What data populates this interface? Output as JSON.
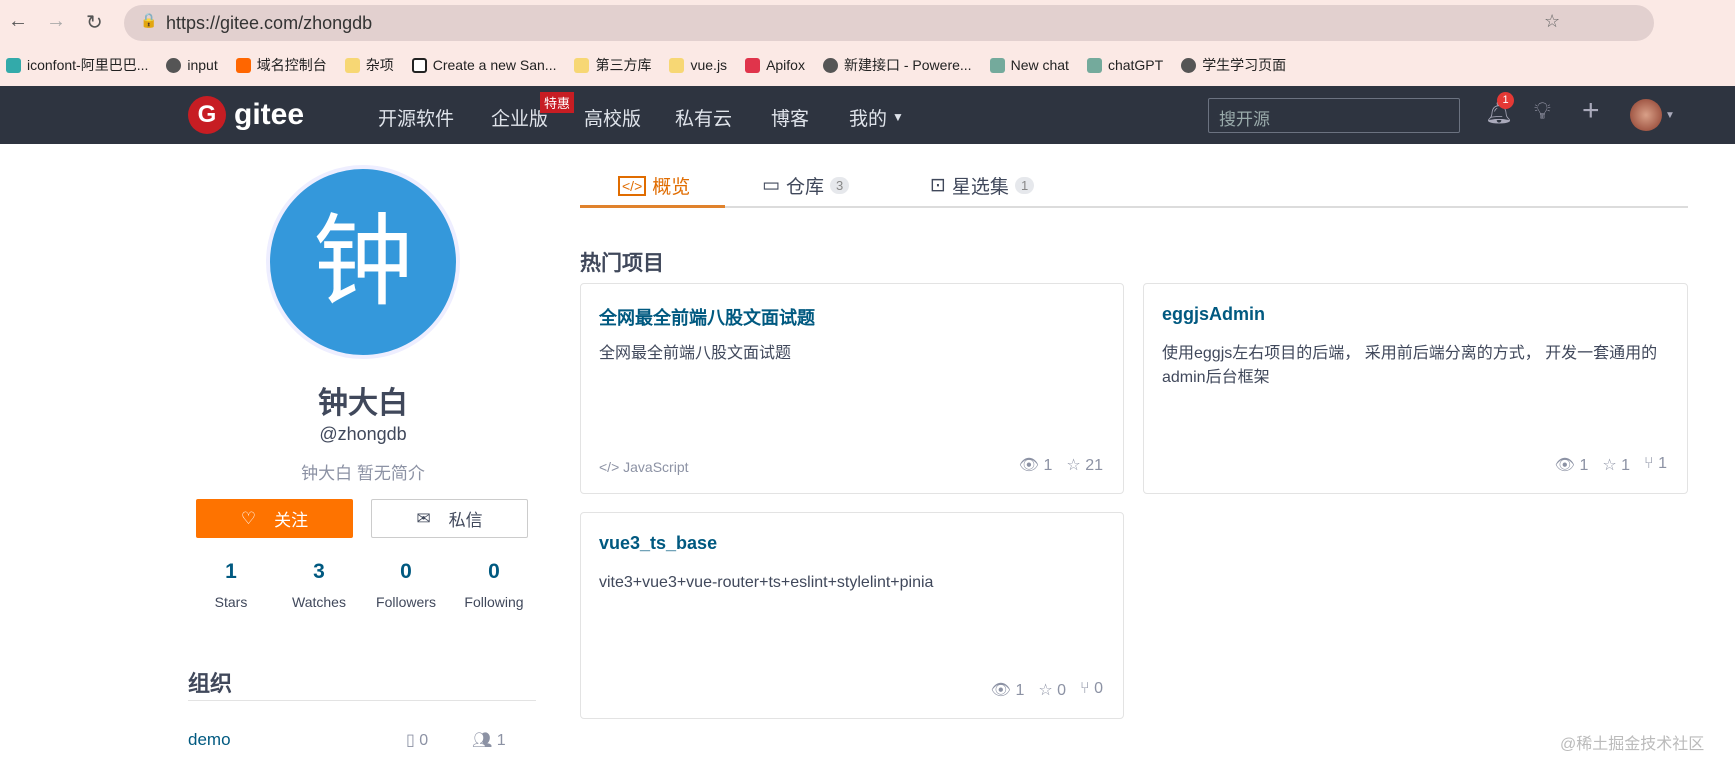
{
  "browser": {
    "url": "https://gitee.com/zhongdb",
    "bookmarks": [
      "iconfont-阿里巴巴...",
      "input",
      "域名控制台",
      "杂项",
      "Create a new San...",
      "第三方库",
      "vue.js",
      "Apifox",
      "新建接口 - Powere...",
      "New chat",
      "chatGPT",
      "学生学习页面"
    ]
  },
  "nav": {
    "logo": "gitee",
    "items": [
      "开源软件",
      "企业版",
      "高校版",
      "私有云",
      "博客",
      "我的"
    ],
    "promo_badge": "特惠",
    "search_placeholder": "搜开源",
    "notification_count": "1"
  },
  "profile": {
    "avatar_char": "钟",
    "name": "钟大白",
    "username": "@zhongdb",
    "bio": "钟大白 暂无简介",
    "follow_label": "关注",
    "message_label": "私信",
    "stats": [
      {
        "value": "1",
        "label": "Stars"
      },
      {
        "value": "3",
        "label": "Watches"
      },
      {
        "value": "0",
        "label": "Followers"
      },
      {
        "value": "0",
        "label": "Following"
      }
    ],
    "org_heading": "组织",
    "orgs": [
      {
        "name": "demo",
        "repos": "0",
        "members": "1"
      }
    ]
  },
  "tabs": [
    {
      "label": "概览"
    },
    {
      "label": "仓库",
      "count": "3"
    },
    {
      "label": "星选集",
      "count": "1"
    }
  ],
  "section_title": "热门项目",
  "projects": [
    {
      "title": "全网最全前端八股文面试题",
      "desc": "全网最全前端八股文面试题",
      "lang": "JavaScript",
      "watch": "1",
      "star": "21"
    },
    {
      "title": "eggjsAdmin",
      "desc": "使用eggjs左右项目的后端， 采用前后端分离的方式， 开发一套通用的admin后台框架",
      "watch": "1",
      "star": "1",
      "fork": "1"
    },
    {
      "title": "vue3_ts_base",
      "desc": "vite3+vue3+vue-router+ts+eslint+stylelint+pinia",
      "watch": "1",
      "star": "0",
      "fork": "0"
    }
  ],
  "watermark": "@稀土掘金技术社区",
  "colors": {
    "accent": "#fe7300",
    "link": "#005980",
    "nav_bg": "#2e3440",
    "avatar_bg": "#3498db"
  }
}
